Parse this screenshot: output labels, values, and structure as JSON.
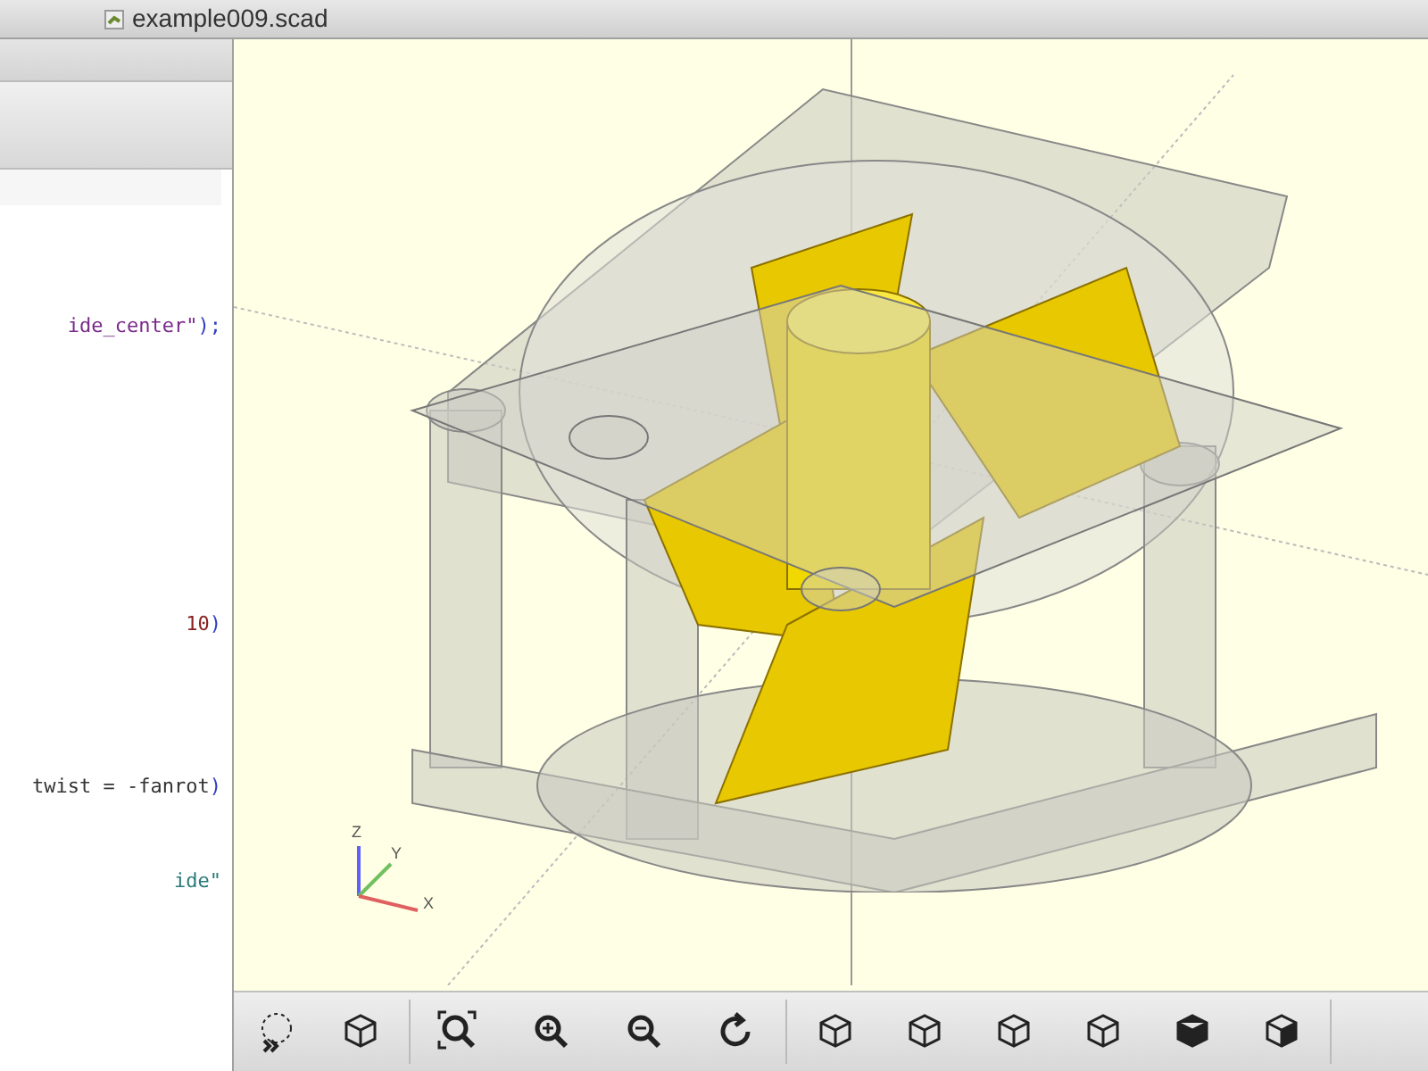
{
  "window": {
    "title": "example009.scad"
  },
  "editor": {
    "lines": [
      {
        "tokens": [
          {
            "kind": "string",
            "text": "ide_center\""
          },
          {
            "kind": "paren",
            "text": ");"
          }
        ]
      },
      {
        "tokens": [
          {
            "kind": "number",
            "text": "10"
          },
          {
            "kind": "paren",
            "text": ")"
          }
        ]
      },
      {
        "tokens": [
          {
            "kind": "plain",
            "text": "twist = -fanrot"
          },
          {
            "kind": "paren",
            "text": ")"
          }
        ]
      },
      {
        "tokens": [
          {
            "kind": "teal",
            "text": "ide\""
          }
        ]
      }
    ]
  },
  "viewport": {
    "axes": {
      "z": "Z",
      "y": "Y",
      "x": "X"
    }
  }
}
